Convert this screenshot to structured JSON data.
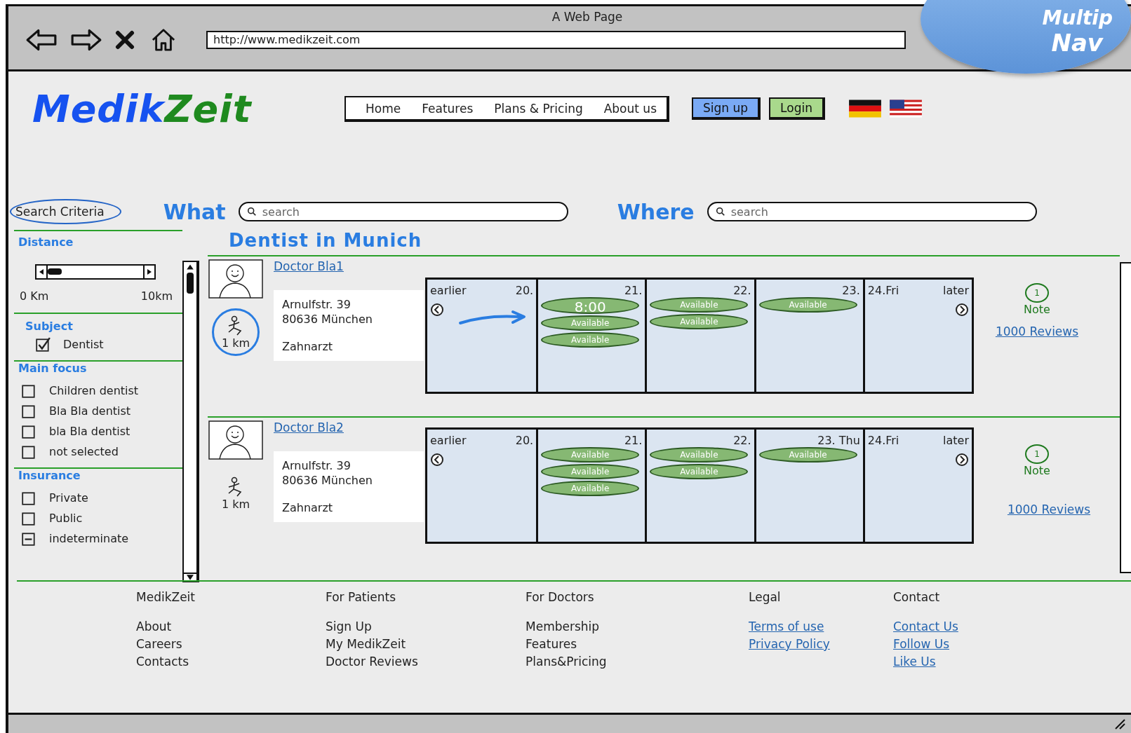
{
  "browser": {
    "title": "A Web Page",
    "url": "http://www.medikzeit.com"
  },
  "callout": {
    "lines": [
      "Multip",
      "Nav"
    ]
  },
  "header": {
    "logo": [
      "Medik",
      "Zeit"
    ],
    "nav": [
      "Home",
      "Features",
      "Plans & Pricing",
      "About us"
    ],
    "signup": "Sign up",
    "login": "Login"
  },
  "search": {
    "criteria": "Search Criteria",
    "what_label": "What",
    "what_placeholder": "search",
    "where_label": "Where",
    "where_placeholder": "search"
  },
  "sidebar": {
    "distance": {
      "title": "Distance",
      "level": 0.15,
      "min": "0 Km",
      "max": "10km"
    },
    "groups": [
      {
        "title": "Subject",
        "items": [
          {
            "label": "Dentist",
            "checked": true,
            "indeterminate": false
          }
        ]
      },
      {
        "title": "Main focus",
        "items": [
          {
            "label": "Children dentist",
            "checked": false,
            "indeterminate": false
          },
          {
            "label": "Bla Bla dentist",
            "checked": false,
            "indeterminate": false
          },
          {
            "label": "bla Bla dentist",
            "checked": false,
            "indeterminate": false
          },
          {
            "label": "not selected",
            "checked": false,
            "indeterminate": false
          }
        ]
      },
      {
        "title": "Insurance",
        "items": [
          {
            "label": "Private",
            "checked": false,
            "indeterminate": false
          },
          {
            "label": "Public",
            "checked": false,
            "indeterminate": false
          },
          {
            "label": "indeterminate",
            "checked": false,
            "indeterminate": true
          }
        ]
      }
    ]
  },
  "results": {
    "title": "Dentist in Munich",
    "doctors": [
      {
        "name": "Doctor Bla1",
        "distance": "1 km",
        "selected": true,
        "address": [
          "Arnulfstr. 39",
          "80636 München"
        ],
        "type": "Zahnarzt",
        "note_count": "1",
        "note": "Note",
        "reviews": "1000 Reviews",
        "calendar": {
          "earlier": "earlier",
          "later": "later",
          "pointer": true,
          "days": [
            {
              "label": "20."
            },
            {
              "label": "21.",
              "slots": [
                {
                  "kind": "time",
                  "label": "8:00"
                },
                {
                  "kind": "open",
                  "label": "Available"
                },
                {
                  "kind": "open",
                  "label": "Available"
                }
              ]
            },
            {
              "label": "22.",
              "slots": [
                {
                  "kind": "open",
                  "label": "Available"
                },
                {
                  "kind": "open",
                  "label": "Available"
                }
              ]
            },
            {
              "label": "23.",
              "slots": [
                {
                  "kind": "open",
                  "label": "Available"
                }
              ]
            },
            {
              "label": "24.Fri"
            }
          ]
        }
      },
      {
        "name": "Doctor Bla2",
        "distance": "1 km",
        "selected": false,
        "address": [
          "Arnulfstr. 39",
          "80636 München"
        ],
        "type": "Zahnarzt",
        "note_count": "1",
        "note": "Note",
        "reviews": "1000 Reviews",
        "calendar": {
          "earlier": "earlier",
          "later": "later",
          "pointer": false,
          "days": [
            {
              "label": "20."
            },
            {
              "label": "21.",
              "slots": [
                {
                  "kind": "open",
                  "label": "Available"
                },
                {
                  "kind": "open",
                  "label": "Available"
                },
                {
                  "kind": "open",
                  "label": "Available"
                }
              ]
            },
            {
              "label": "22.",
              "slots": [
                {
                  "kind": "open",
                  "label": "Available"
                },
                {
                  "kind": "open",
                  "label": "Available"
                }
              ]
            },
            {
              "label": "23. Thu",
              "slots": [
                {
                  "kind": "open",
                  "label": "Available"
                }
              ]
            },
            {
              "label": "24.Fri"
            }
          ]
        }
      }
    ]
  },
  "footer": [
    {
      "title": "MedikZeit",
      "kind": "plain",
      "items": [
        "About",
        "Careers",
        "Contacts"
      ]
    },
    {
      "title": "For Patients",
      "kind": "plain",
      "items": [
        "Sign Up",
        "My MedikZeit",
        "Doctor Reviews"
      ]
    },
    {
      "title": "For Doctors",
      "kind": "plain",
      "items": [
        "Membership",
        "Features",
        "Plans&Pricing"
      ]
    },
    {
      "title": "Legal",
      "kind": "link",
      "items": [
        "Terms of use",
        "Privacy Policy"
      ]
    },
    {
      "title": "Contact",
      "kind": "link",
      "items": [
        "Contact Us",
        "Follow Us",
        "Like Us"
      ]
    }
  ]
}
